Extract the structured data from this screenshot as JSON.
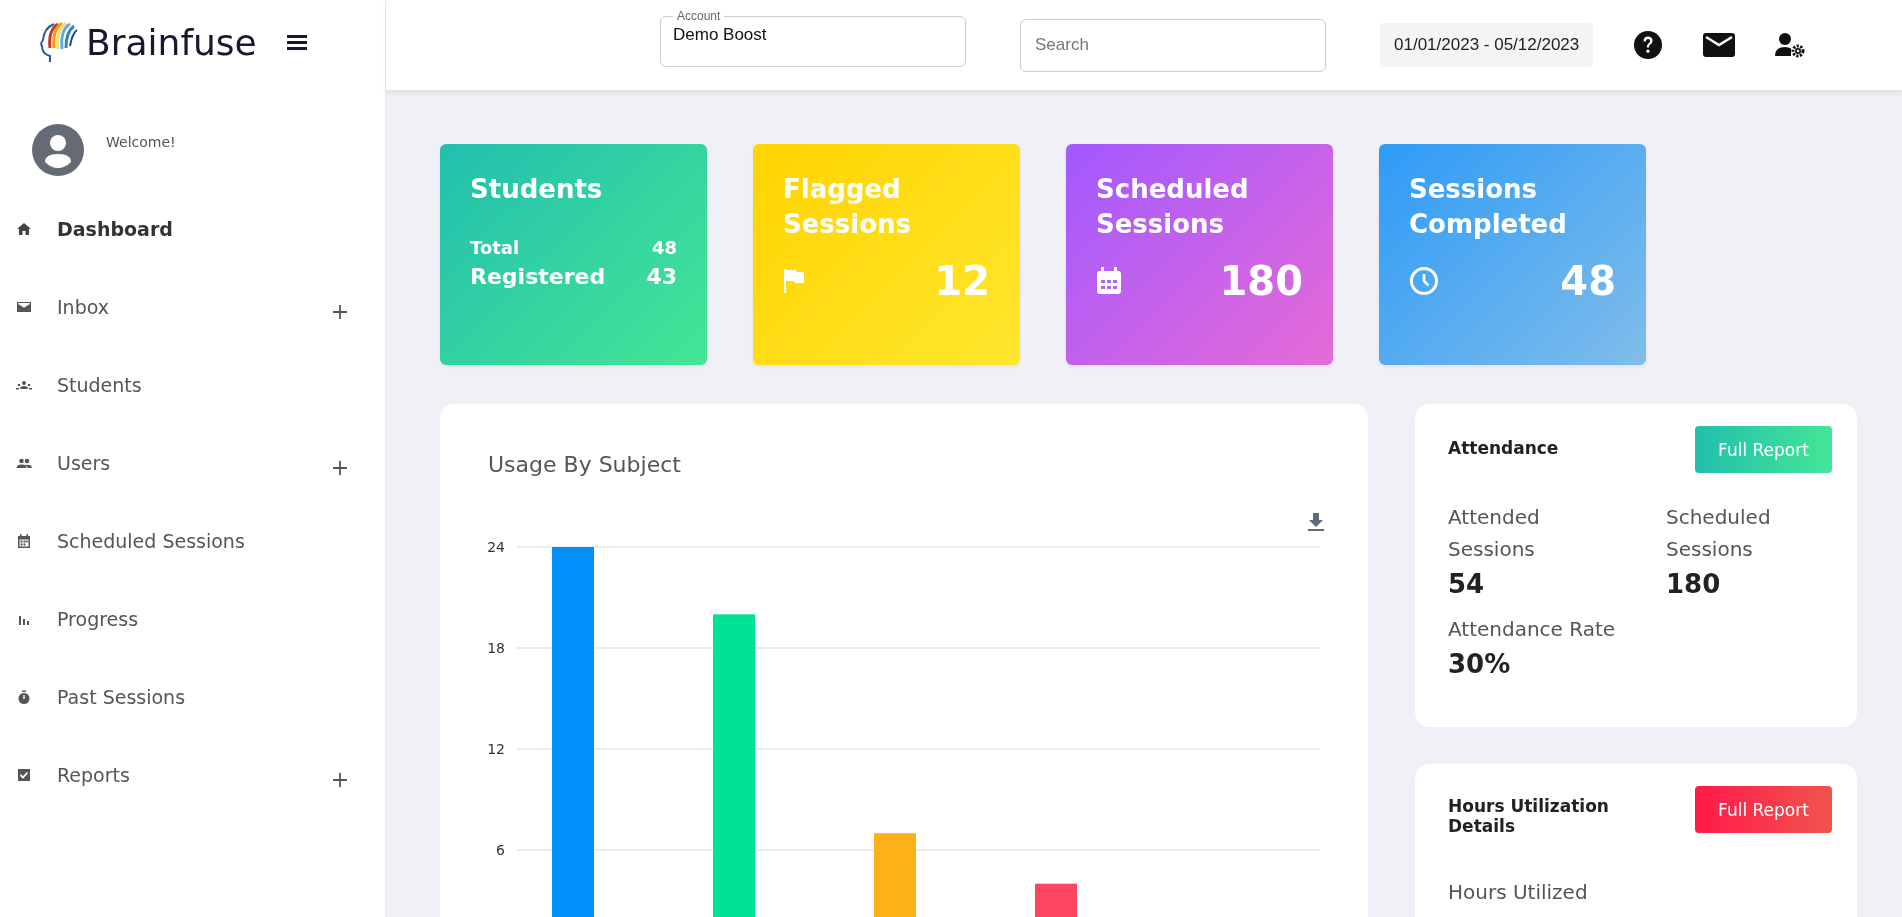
{
  "brand": {
    "name": "Brainfuse"
  },
  "user": {
    "greeting": "Welcome!"
  },
  "sidebar": {
    "items": [
      {
        "label": "Dashboard",
        "selected": true,
        "expandable": false
      },
      {
        "label": "Inbox",
        "selected": false,
        "expandable": true
      },
      {
        "label": "Students",
        "selected": false,
        "expandable": false
      },
      {
        "label": "Users",
        "selected": false,
        "expandable": true
      },
      {
        "label": "Scheduled Sessions",
        "selected": false,
        "expandable": false
      },
      {
        "label": "Progress",
        "selected": false,
        "expandable": false
      },
      {
        "label": "Past Sessions",
        "selected": false,
        "expandable": false
      },
      {
        "label": "Reports",
        "selected": false,
        "expandable": true
      }
    ]
  },
  "header": {
    "account": {
      "label": "Account",
      "value": "Demo Boost"
    },
    "search": {
      "placeholder": "Search"
    },
    "date_range": "01/01/2023 - 05/12/2023"
  },
  "cards": [
    {
      "kind": "students",
      "title": "Students",
      "rows": [
        {
          "label": "Total",
          "value": "48"
        },
        {
          "label": "Registered",
          "value": "43"
        }
      ]
    },
    {
      "kind": "flagged",
      "title": "Flagged Sessions",
      "value": "12"
    },
    {
      "kind": "scheduled",
      "title": "Scheduled Sessions",
      "value": "180"
    },
    {
      "kind": "completed",
      "title": "Sessions Completed",
      "value": "48"
    }
  ],
  "usage_chart": {
    "chart_data": {
      "type": "bar",
      "title": "Usage By Subject",
      "values": [
        24,
        20,
        7,
        4
      ],
      "colors": [
        "#008ffb",
        "#00e396",
        "#feb019",
        "#ff4560"
      ],
      "ylim": [
        0,
        24
      ],
      "grid": true,
      "yticks": [
        6,
        12,
        18,
        24
      ]
    }
  },
  "attendance": {
    "title": "Attendance",
    "button": "Full Report",
    "stats": [
      {
        "label": "Attended Sessions",
        "value": "54"
      },
      {
        "label": "Scheduled Sessions",
        "value": "180"
      },
      {
        "label": "Attendance Rate",
        "value": "30%"
      }
    ]
  },
  "hours": {
    "title": "Hours Utilization Details",
    "button": "Full Report",
    "stats": [
      {
        "label": "Hours Utilized"
      }
    ]
  }
}
